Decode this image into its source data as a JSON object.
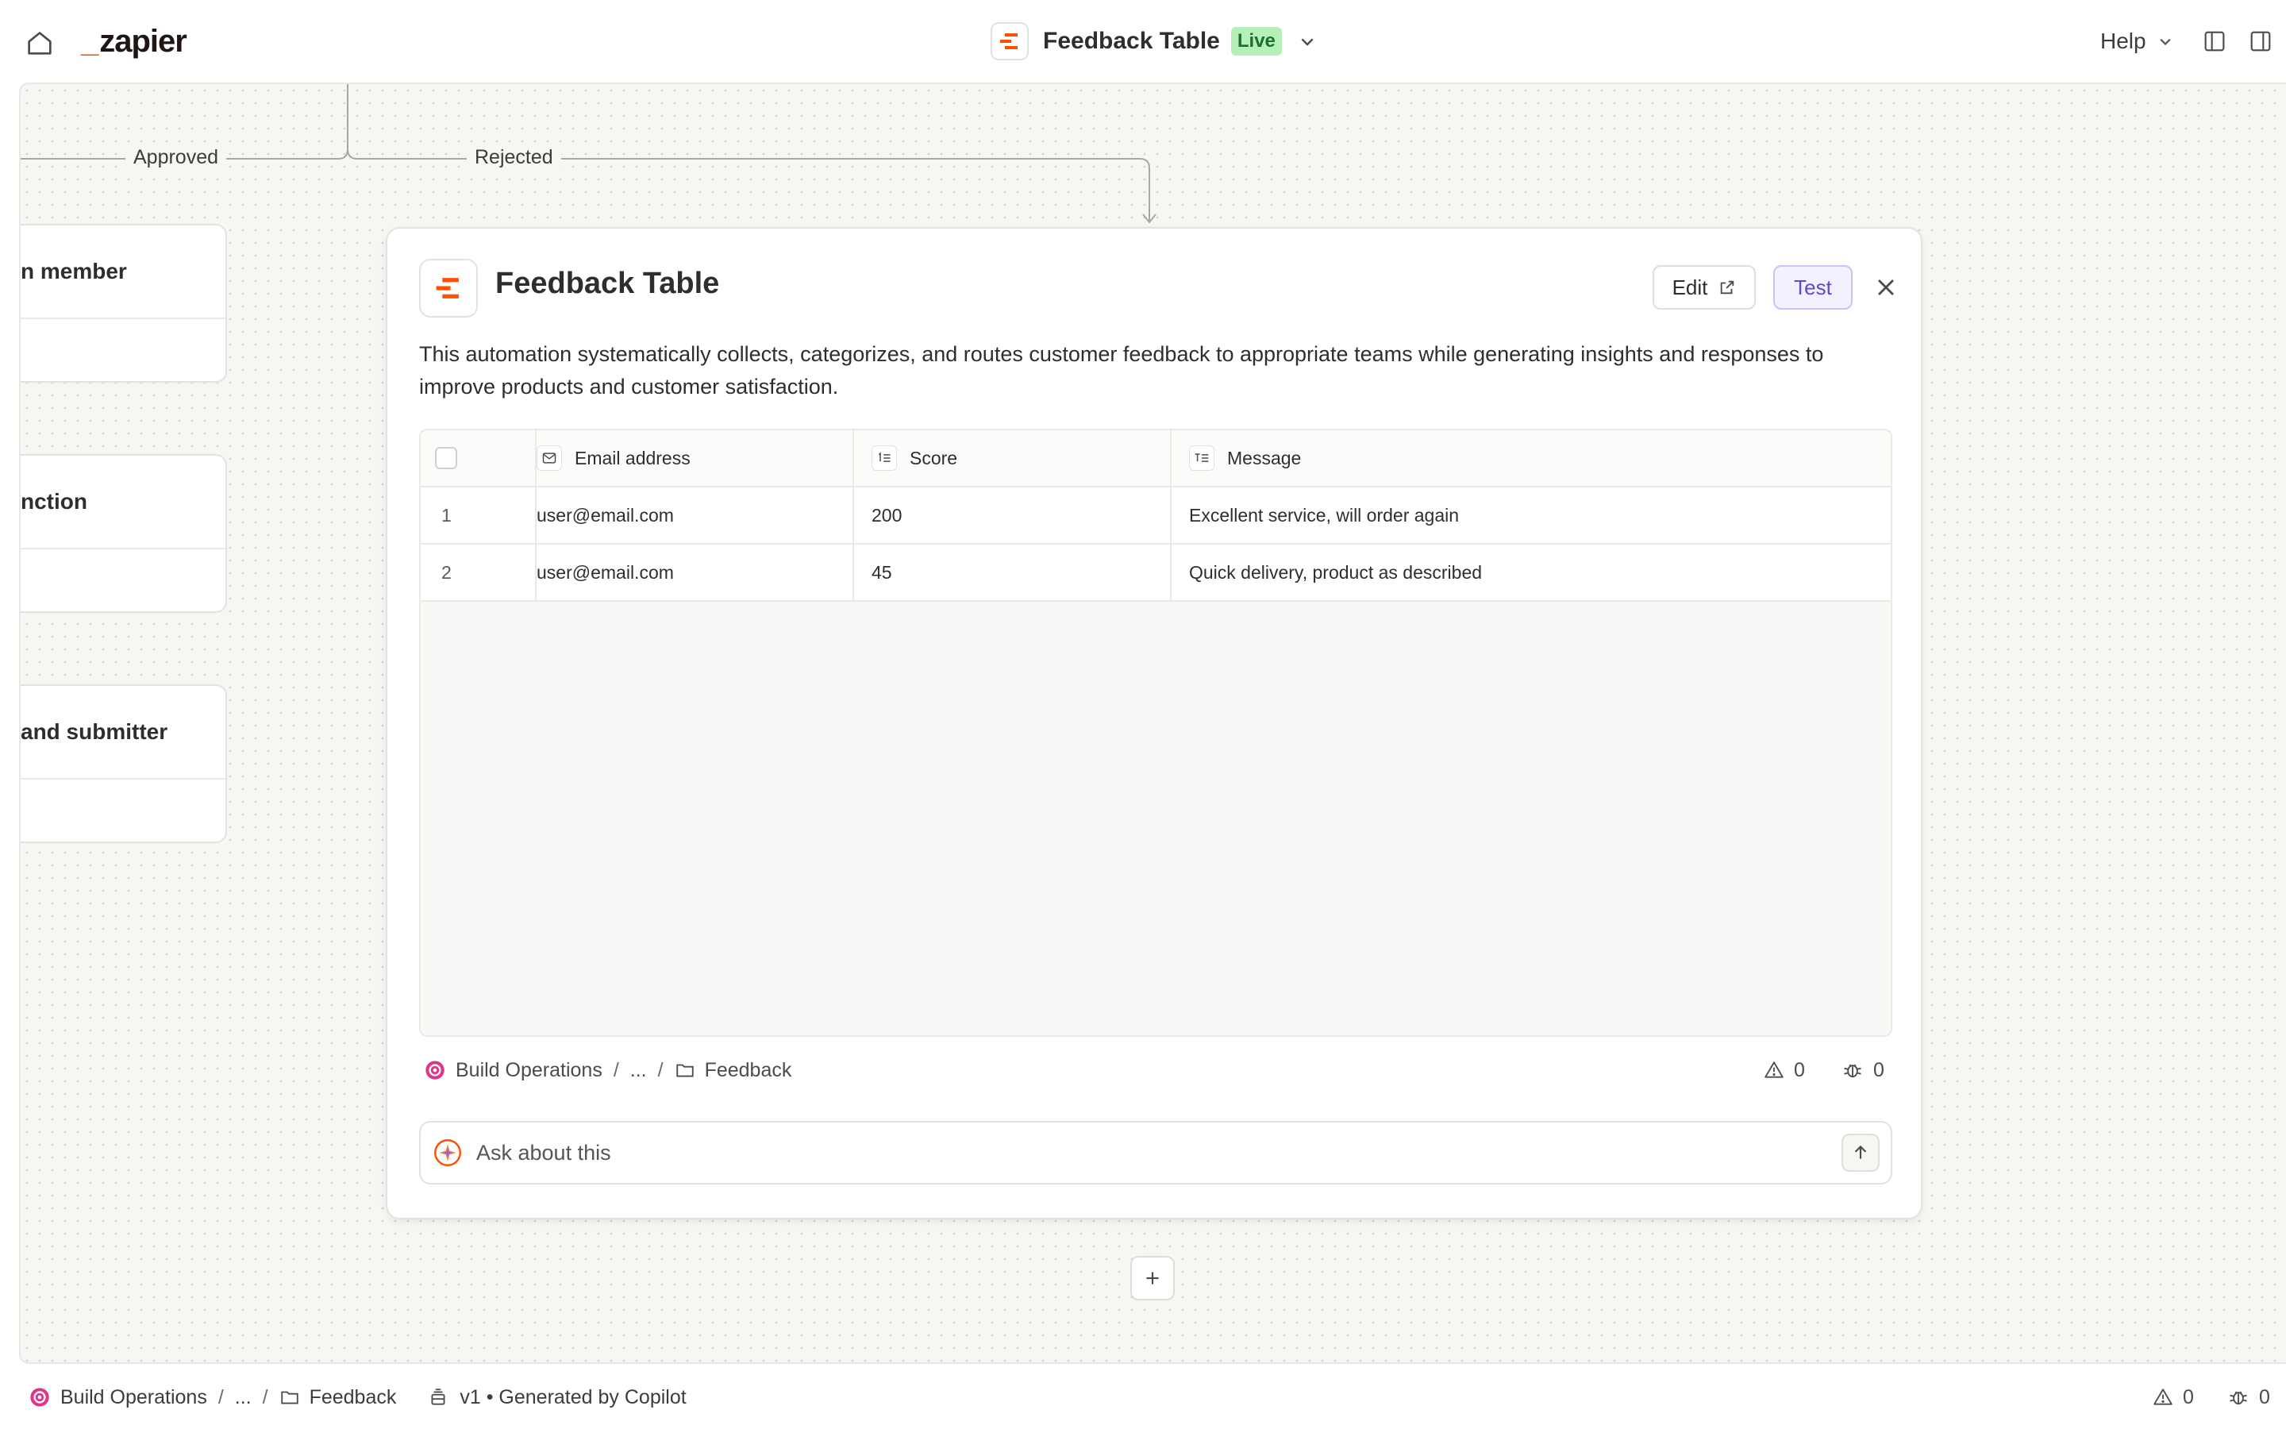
{
  "app": {
    "logo_text": "zapier",
    "brand_color": "#ff4f00"
  },
  "header": {
    "title": "Feedback Table",
    "status_badge": "Live",
    "help_label": "Help"
  },
  "canvas": {
    "branch_labels": [
      "Approved",
      "Rejected"
    ],
    "side_cards": [
      {
        "label": "n member"
      },
      {
        "label": "nction"
      },
      {
        "label": " and submitter"
      }
    ]
  },
  "panel": {
    "title": "Feedback Table",
    "edit_label": "Edit",
    "test_label": "Test",
    "description": "This automation systematically collects, categorizes, and routes customer feedback to appropriate teams while generating insights and responses to improve products and customer satisfaction.",
    "table": {
      "columns": [
        "Email address",
        "Score",
        "Message"
      ],
      "rows": [
        {
          "index": "1",
          "email": "user@email.com",
          "score": "200",
          "message": "Excellent service, will order again"
        },
        {
          "index": "2",
          "email": "user@email.com",
          "score": "45",
          "message": "Quick delivery, product as described"
        }
      ]
    },
    "breadcrumb": {
      "root": "Build Operations",
      "ellipsis": "...",
      "folder": "Feedback"
    },
    "warnings_count": "0",
    "errors_count": "0",
    "ask_placeholder": "Ask about this"
  },
  "statusbar": {
    "breadcrumb": {
      "root": "Build Operations",
      "ellipsis": "...",
      "folder": "Feedback"
    },
    "version_text": "v1 • Generated by Copilot",
    "warnings_count": "0",
    "errors_count": "0"
  },
  "colors": {
    "live_badge_bg": "#b6f0b9",
    "test_button_text": "#5a4bd1",
    "canvas_bg": "#f7f6f3",
    "org_icon": "#e0348b"
  },
  "icons": [
    "home-icon",
    "chevron-down-icon",
    "sidebar-left-icon",
    "sidebar-right-icon",
    "table-app-icon",
    "external-link-icon",
    "close-icon",
    "mail-icon",
    "number-field-icon",
    "text-field-icon",
    "org-icon",
    "folder-icon",
    "warning-icon",
    "bug-icon",
    "copilot-spark-icon",
    "arrow-up-icon",
    "plus-icon",
    "version-stack-icon"
  ]
}
